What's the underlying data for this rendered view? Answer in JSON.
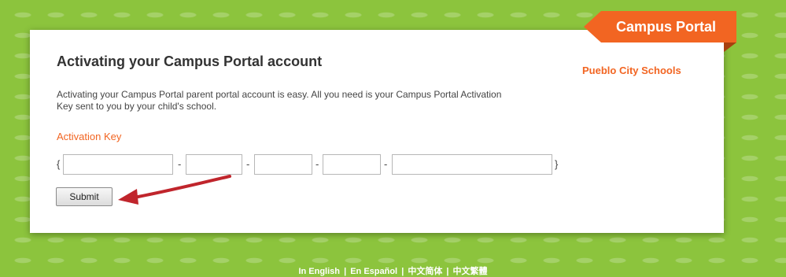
{
  "brand": {
    "tab_label": "Campus Portal",
    "district": "Pueblo City Schools"
  },
  "main": {
    "heading": "Activating your Campus Portal account",
    "description": "Activating your Campus Portal parent portal account is easy. All you need is your Campus Portal Activation Key sent to you by your child's school.",
    "activation_label": "Activation Key",
    "brace_open": "{",
    "brace_close": "}",
    "dash": "-",
    "key_fields": [
      "",
      "",
      "",
      "",
      ""
    ],
    "submit_label": "Submit"
  },
  "footer": {
    "languages": [
      "In English",
      "En Español",
      "中文简体",
      "中文繁體"
    ],
    "separator": "|"
  },
  "colors": {
    "accent": "#f26522",
    "background": "#8cc43d",
    "arrow": "#c0252c"
  },
  "icons": [
    "annotation-arrow-icon"
  ]
}
